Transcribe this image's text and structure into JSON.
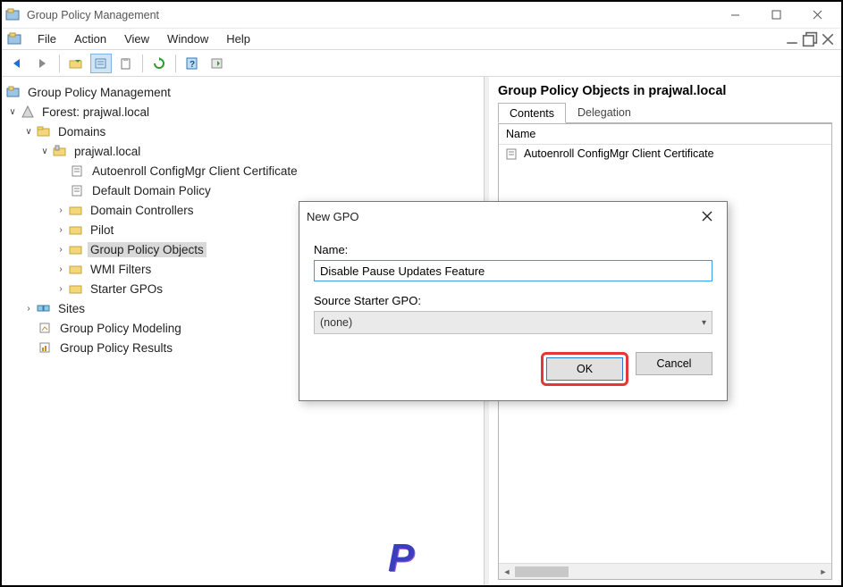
{
  "window": {
    "title": "Group Policy Management",
    "min_tip": "Minimize",
    "max_tip": "Restore",
    "close_tip": "Close"
  },
  "menus": {
    "file": "File",
    "action": "Action",
    "view": "View",
    "window": "Window",
    "help": "Help"
  },
  "toolbar_icons": {
    "back": "back-arrow-icon",
    "forward": "forward-arrow-icon",
    "up": "folder-up-icon",
    "props": "properties-icon",
    "clipboard": "clipboard-icon",
    "refresh": "refresh-icon",
    "help": "help-icon",
    "export": "export-icon"
  },
  "tree": {
    "root": "Group Policy Management",
    "forest": "Forest: prajwal.local",
    "domains": "Domains",
    "domain": "prajwal.local",
    "gpo1": "Autoenroll ConfigMgr Client Certificate",
    "gpo2": "Default Domain Policy",
    "dc": "Domain Controllers",
    "pilot": "Pilot",
    "gpo_container": "Group Policy Objects",
    "wmi": "WMI Filters",
    "starter": "Starter GPOs",
    "sites": "Sites",
    "modeling": "Group Policy Modeling",
    "results": "Group Policy Results"
  },
  "right": {
    "title": "Group Policy Objects in prajwal.local",
    "tabs": {
      "contents": "Contents",
      "delegation": "Delegation"
    },
    "col_name": "Name",
    "rows": [
      "Autoenroll ConfigMgr Client Certificate"
    ]
  },
  "dialog": {
    "title": "New GPO",
    "name_label": "Name:",
    "name_value": "Disable Pause Updates Feature",
    "starter_label": "Source Starter GPO:",
    "starter_value": "(none)",
    "ok": "OK",
    "cancel": "Cancel",
    "close_tip": "Close"
  },
  "watermark": "P",
  "colors": {
    "accent": "#3a9be6",
    "highlight_red": "#e83535"
  }
}
